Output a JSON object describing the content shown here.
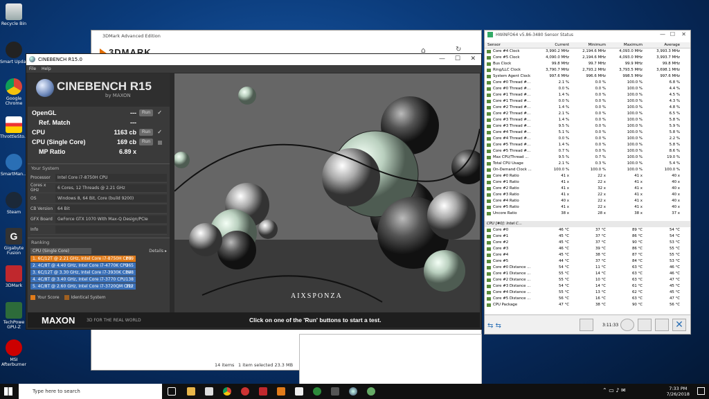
{
  "desktop_icons": [
    {
      "label": "Recycle Bin"
    },
    {
      "label": "Smart Updat"
    },
    {
      "label": "Google Chrome"
    },
    {
      "label": "ThrottleSto..."
    },
    {
      "label": "SmartMan..."
    },
    {
      "label": "Steam"
    },
    {
      "label": "Gigabyte Fusion"
    },
    {
      "label": "3DMark"
    },
    {
      "label": "TechPowe GPU-Z"
    },
    {
      "label": "MSI Afterburner"
    }
  ],
  "threedmark": {
    "title": "3DMark Advanced Edition",
    "logo": "3DMARK",
    "status_items": "14 items",
    "status_selected": "1 item selected  23.3 MB"
  },
  "cinebench": {
    "title": "CINEBENCH R15.0",
    "menu": [
      "File",
      "Help"
    ],
    "logo_title": "CINEBENCH R15",
    "logo_sub": "by MAXON",
    "scores": [
      {
        "label": "OpenGL",
        "value": "---",
        "run": "Run",
        "check": "✓"
      },
      {
        "label": "Ref. Match",
        "value": "---"
      },
      {
        "label": "CPU",
        "value": "1163 cb",
        "run": "Run",
        "check": "✓"
      },
      {
        "label": "CPU (Single Core)",
        "value": "169 cb",
        "run": "Run"
      },
      {
        "label": "MP Ratio",
        "value": "6.89 x"
      }
    ],
    "system_header": "Your System",
    "system": [
      {
        "k": "Processor",
        "v": "Intel Core i7-8750H CPU"
      },
      {
        "k": "Cores x GHz",
        "v": "6 Cores, 12 Threads @ 2.21 GHz"
      },
      {
        "k": "OS",
        "v": "Windows 8, 64 Bit, Core (build 9200)"
      },
      {
        "k": "CB Version",
        "v": "64 Bit"
      },
      {
        "k": "GFX Board",
        "v": "GeForce GTX 1070 With Max-Q Design/PCIe"
      },
      {
        "k": "Info",
        "v": ""
      }
    ],
    "ranking_header": "Ranking",
    "ranking_select": "CPU (Single Core)",
    "details": "Details",
    "ranking": [
      {
        "t": "1. 6C/12T @ 2.21 GHz, Intel Core i7-8750H CPU",
        "s": "169",
        "color": "#e07b1a"
      },
      {
        "t": "2. 4C/8T @ 4.40 GHz, Intel Core i7-4770K CPU",
        "s": "165",
        "color": "#3a70b8"
      },
      {
        "t": "3. 6C/12T @ 3.30 GHz,  Intel Core i7-3930K CPU",
        "s": "148",
        "color": "#3a70b8"
      },
      {
        "t": "4. 4C/8T @ 3.40 GHz, Intel Core i7-3770 CPU",
        "s": "138",
        "color": "#3a70b8"
      },
      {
        "t": "5. 4C/8T @ 2.60 GHz, Intel Core i7-3720QM CPU",
        "s": "122",
        "color": "#3a70b8"
      }
    ],
    "legend_score": "Your Score",
    "legend_identical": "Identical System",
    "footer_brand": "MAXON",
    "footer_tagline": "3D FOR THE REAL WORLD",
    "footer_msg": "Click on one of the 'Run' buttons to start a test.",
    "render_brand": "AIXSPONZA"
  },
  "hwinfo": {
    "title": "HWiNFO64 v5.86-3480 Sensor Status",
    "columns": [
      "Sensor",
      "Current",
      "Minimum",
      "Maximum",
      "Average"
    ],
    "rows": [
      [
        "Core #4 Clock",
        "3,990.2 MHz",
        "2,194.6 MHz",
        "4,093.0 MHz",
        "3,993.3 MHz"
      ],
      [
        "Core #5 Clock",
        "4,090.0 MHz",
        "2,194.6 MHz",
        "4,093.0 MHz",
        "3,993.7 MHz"
      ],
      [
        "Bus Clock",
        "99.8 MHz",
        "99.7 MHz",
        "99.9 MHz",
        "99.8 MHz"
      ],
      [
        "Ring/LLC Clock",
        "3,790.7 MHz",
        "2,793.2 MHz",
        "3,793.5 MHz",
        "3,698.1 MHz"
      ],
      [
        "System Agent Clock",
        "997.6 MHz",
        "996.6 MHz",
        "998.5 MHz",
        "997.6 MHz"
      ],
      [
        "Core #0 Thread #...",
        "2.1 %",
        "0.0 %",
        "100.0 %",
        "6.8 %"
      ],
      [
        "Core #0 Thread #...",
        "0.0 %",
        "0.0 %",
        "100.0 %",
        "4.4 %"
      ],
      [
        "Core #1 Thread #...",
        "1.4 %",
        "0.0 %",
        "100.0 %",
        "4.5 %"
      ],
      [
        "Core #1 Thread #...",
        "0.0 %",
        "0.0 %",
        "100.0 %",
        "4.3 %"
      ],
      [
        "Core #2 Thread #...",
        "1.4 %",
        "0.0 %",
        "100.0 %",
        "4.8 %"
      ],
      [
        "Core #2 Thread #...",
        "2.1 %",
        "0.0 %",
        "100.0 %",
        "6.5 %"
      ],
      [
        "Core #3 Thread #...",
        "1.4 %",
        "0.0 %",
        "100.0 %",
        "5.8 %"
      ],
      [
        "Core #3 Thread #...",
        "9.5 %",
        "0.0 %",
        "100.0 %",
        "5.9 %"
      ],
      [
        "Core #4 Thread #...",
        "5.1 %",
        "0.0 %",
        "100.0 %",
        "5.8 %"
      ],
      [
        "Core #4 Thread #...",
        "0.0 %",
        "0.0 %",
        "100.0 %",
        "2.2 %"
      ],
      [
        "Core #5 Thread #...",
        "1.4 %",
        "0.0 %",
        "100.0 %",
        "5.8 %"
      ],
      [
        "Core #5 Thread #...",
        "0.7 %",
        "0.0 %",
        "100.0 %",
        "8.6 %"
      ],
      [
        "Max CPU/Thread ...",
        "9.5 %",
        "0.7 %",
        "100.0 %",
        "19.0 %"
      ],
      [
        "Total CPU Usage",
        "2.1 %",
        "0.3 %",
        "100.0 %",
        "5.4 %"
      ],
      [
        "On-Demand Clock ...",
        "100.0 %",
        "100.0 %",
        "100.0 %",
        "100.0 %"
      ],
      [
        "Core #0 Ratio",
        "41 x",
        "22 x",
        "41 x",
        "40 x"
      ],
      [
        "Core #1 Ratio",
        "41 x",
        "22 x",
        "41 x",
        "40 x"
      ],
      [
        "Core #2 Ratio",
        "41 x",
        "32 x",
        "41 x",
        "40 x"
      ],
      [
        "Core #3 Ratio",
        "41 x",
        "22 x",
        "41 x",
        "40 x"
      ],
      [
        "Core #4 Ratio",
        "40 x",
        "22 x",
        "41 x",
        "40 x"
      ],
      [
        "Core #5 Ratio",
        "41 x",
        "22 x",
        "41 x",
        "40 x"
      ],
      [
        "Uncore Ratio",
        "38 x",
        "28 x",
        "38 x",
        "37 x"
      ]
    ],
    "group2": "CPU [#0]: Intel C...",
    "rows2": [
      [
        "Core #0",
        "46 °C",
        "37 °C",
        "89 °C",
        "54 °C"
      ],
      [
        "Core #1",
        "45 °C",
        "37 °C",
        "86 °C",
        "54 °C"
      ],
      [
        "Core #2",
        "45 °C",
        "37 °C",
        "90 °C",
        "53 °C"
      ],
      [
        "Core #3",
        "46 °C",
        "39 °C",
        "86 °C",
        "55 °C"
      ],
      [
        "Core #4",
        "45 °C",
        "38 °C",
        "87 °C",
        "55 °C"
      ],
      [
        "Core #5",
        "44 °C",
        "37 °C",
        "84 °C",
        "53 °C"
      ],
      [
        "Core #0 Distance ...",
        "54 °C",
        "11 °C",
        "63 °C",
        "46 °C"
      ],
      [
        "Core #1 Distance ...",
        "55 °C",
        "14 °C",
        "63 °C",
        "46 °C"
      ],
      [
        "Core #2 Distance ...",
        "55 °C",
        "10 °C",
        "63 °C",
        "47 °C"
      ],
      [
        "Core #3 Distance ...",
        "54 °C",
        "14 °C",
        "61 °C",
        "45 °C"
      ],
      [
        "Core #4 Distance ...",
        "55 °C",
        "13 °C",
        "62 °C",
        "45 °C"
      ],
      [
        "Core #5 Distance ...",
        "56 °C",
        "16 °C",
        "63 °C",
        "47 °C"
      ],
      [
        "CPU Package",
        "47 °C",
        "38 °C",
        "90 °C",
        "56 °C"
      ]
    ],
    "timer": "3:11:33"
  },
  "taskbar": {
    "search": "Type here to search",
    "time": "7:33 PM",
    "date": "7/26/2018"
  }
}
